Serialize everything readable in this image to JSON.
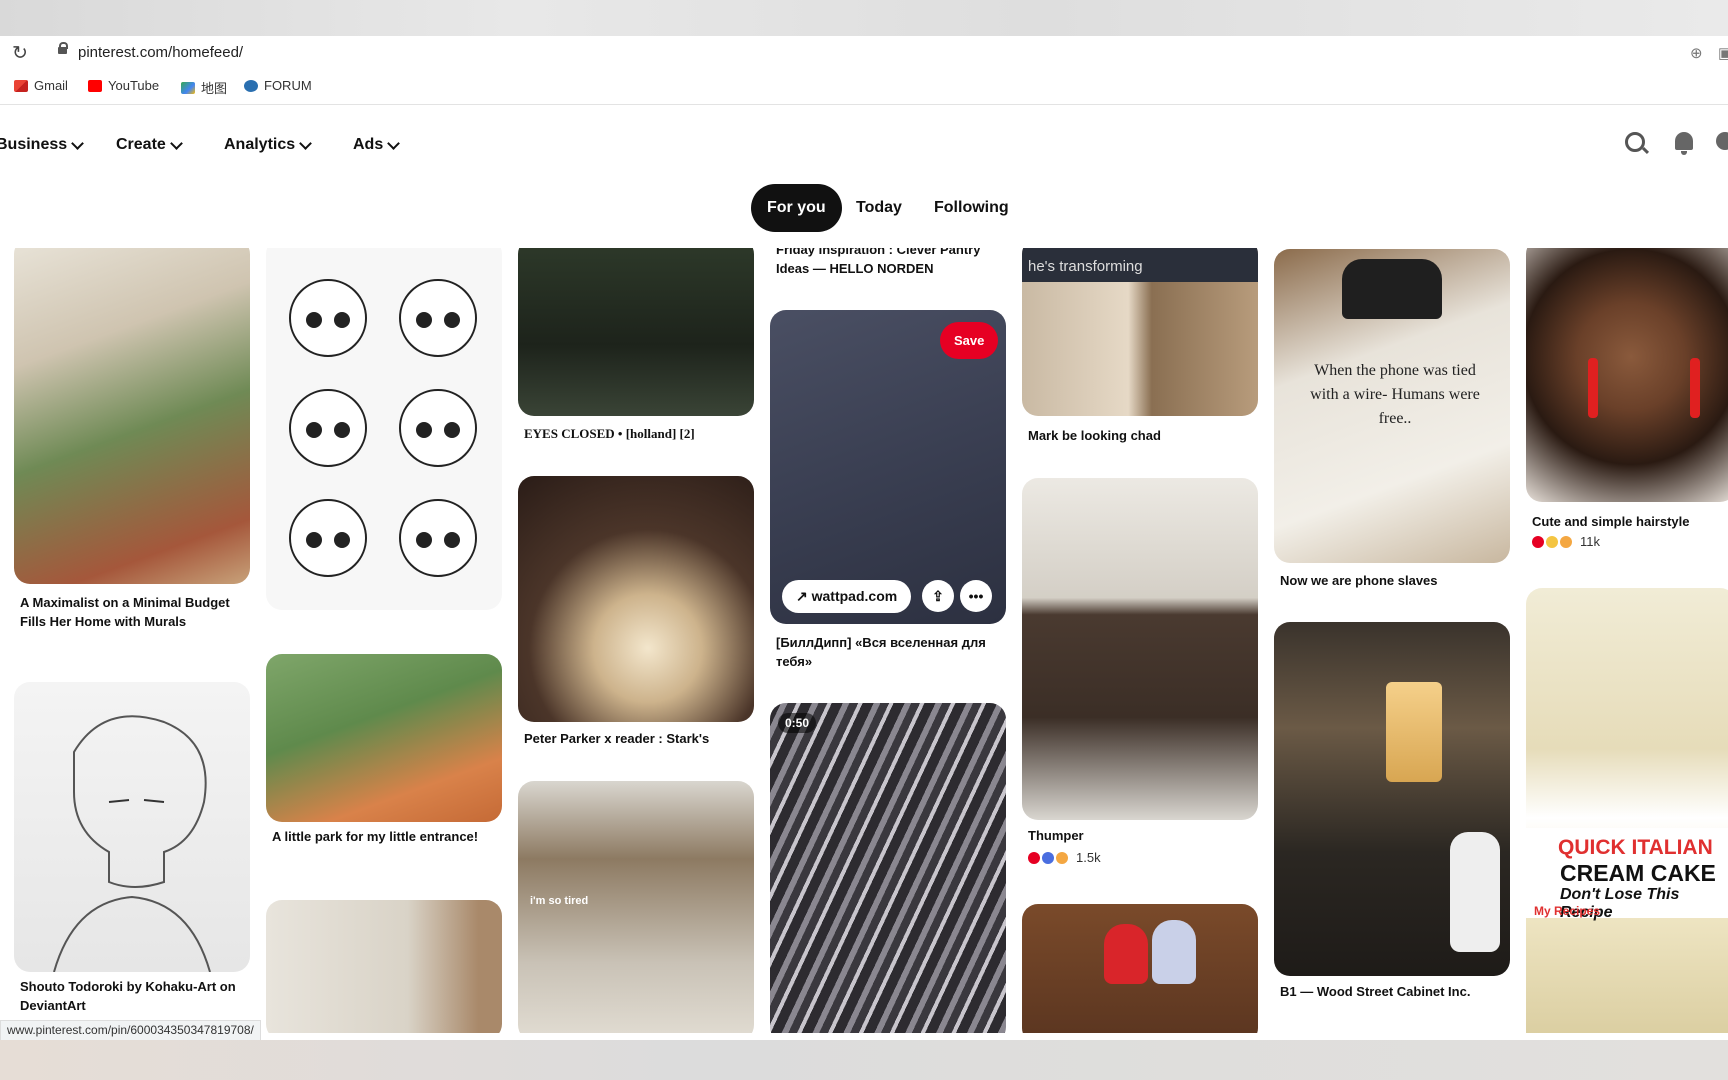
{
  "browser": {
    "url": "pinterest.com/homefeed/",
    "bookmarks": [
      "Gmail",
      "YouTube",
      "地图",
      "FORUM"
    ]
  },
  "nav": {
    "items": [
      "Business",
      "Create",
      "Analytics",
      "Ads"
    ]
  },
  "tabs": {
    "for_you": "For you",
    "today": "Today",
    "following": "Following"
  },
  "pins": {
    "p1": {
      "caption": "A Maximalist on a Minimal Budget Fills Her Home with Murals"
    },
    "p2": {
      "caption": "Shouto Todoroki by Kohaku-Art on DeviantArt"
    },
    "p3": {
      "caption": "A little park for my little entrance!"
    },
    "p4": {
      "caption": "EYES CLOSED • [holland] [2]"
    },
    "p5": {
      "caption": "Peter Parker x reader : Stark's"
    },
    "p6": {
      "overlay": "i'm so tired"
    },
    "p7": {
      "caption": "Friday Inspiration : Clever Pantry Ideas — HELLO NORDEN"
    },
    "p8": {
      "caption": "[БиллДипп] «Вся вселенная для тебя»",
      "save": "Save",
      "link": "wattpad.com"
    },
    "p9": {
      "duration": "0:50"
    },
    "p10": {
      "overlay": "he's transforming",
      "caption": "Mark be looking chad"
    },
    "p11": {
      "caption": "Thumper",
      "count": "1.5k"
    },
    "p12": {
      "overlay": "When the phone was tied with a wire- Humans were free..",
      "caption": "Now we are phone slaves"
    },
    "p13": {
      "caption": "B1 — Wood Street Cabinet Inc."
    },
    "p14": {
      "caption": "Cute and simple hairstyle",
      "count": "11k"
    },
    "p15": {
      "title1": "QUICK ITALIAN",
      "title2": "CREAM CAKE",
      "subtitle": "Don't Lose This Recipe",
      "brand": "My Recipes"
    }
  },
  "status_url": "www.pinterest.com/pin/600034350347819708/",
  "colors": {
    "accent": "#e60023",
    "active_tab": "#111111"
  }
}
